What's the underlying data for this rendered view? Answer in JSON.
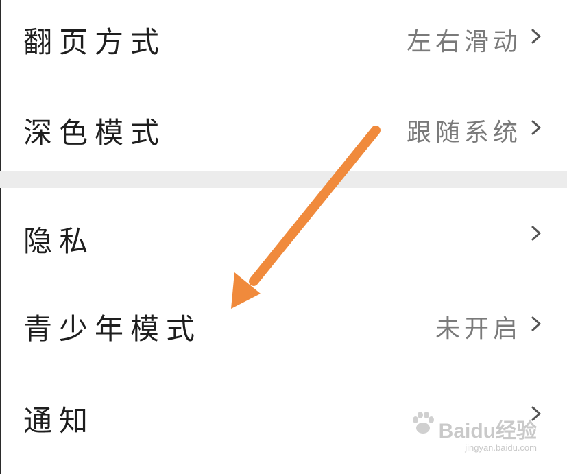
{
  "settings": {
    "page_turn": {
      "label": "翻页方式",
      "value": "左右滑动",
      "icon": "chevron-right-icon"
    },
    "dark_mode": {
      "label": "深色模式",
      "value": "跟随系统",
      "icon": "chevron-right-icon"
    },
    "privacy": {
      "label": "隐私",
      "icon": "chevron-right-icon"
    },
    "teen_mode": {
      "label": "青少年模式",
      "value": "未开启",
      "icon": "chevron-right-icon"
    },
    "notifications": {
      "label": "通知",
      "icon": "chevron-right-icon"
    }
  },
  "annotation": {
    "icon": "arrow-annotation-icon",
    "color": "#f08a3c"
  },
  "watermark": {
    "brand": "Baidu经验",
    "url": "jingyan.baidu.com",
    "icon": "paw-logo-icon"
  }
}
